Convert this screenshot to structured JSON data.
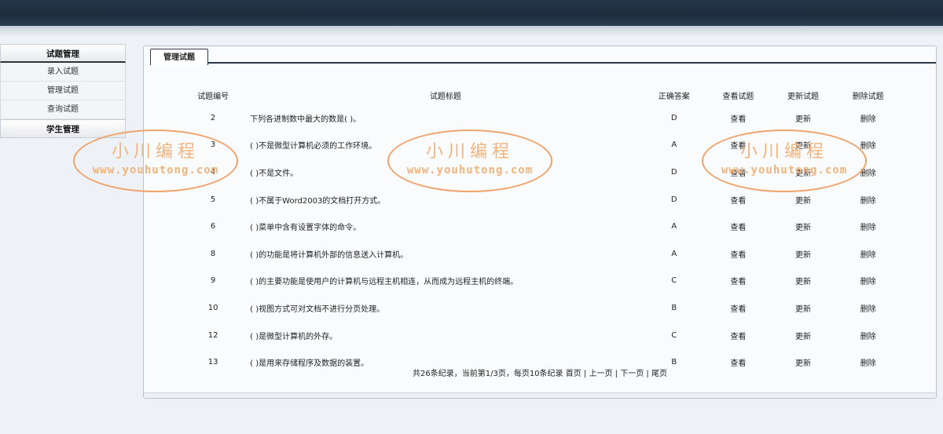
{
  "sidebar": {
    "sections": [
      {
        "label": "试题管理",
        "items": [
          "录入试题",
          "管理试题",
          "查询试题"
        ]
      },
      {
        "label": "学生管理",
        "items": []
      }
    ]
  },
  "main": {
    "tab_label": "管理试题",
    "columns": [
      "试题编号",
      "试题标题",
      "正确答案",
      "查看试题",
      "更新试题",
      "删除试题"
    ],
    "rows": [
      {
        "id": "2",
        "title": "下列各进制数中最大的数是( )。",
        "answer": "D",
        "view": "查看",
        "update": "更新",
        "delete": "删除"
      },
      {
        "id": "3",
        "title": "( )不是微型计算机必须的工作环境。",
        "answer": "A",
        "view": "查看",
        "update": "更新",
        "delete": "删除"
      },
      {
        "id": "4",
        "title": "( )不是文件。",
        "answer": "D",
        "view": "查看",
        "update": "更新",
        "delete": "删除"
      },
      {
        "id": "5",
        "title": "( )不属于Word2003的文档打开方式。",
        "answer": "D",
        "view": "查看",
        "update": "更新",
        "delete": "删除"
      },
      {
        "id": "6",
        "title": "( )菜单中含有设置字体的命令。",
        "answer": "A",
        "view": "查看",
        "update": "更新",
        "delete": "删除"
      },
      {
        "id": "8",
        "title": "( )的功能是将计算机外部的信息送入计算机。",
        "answer": "A",
        "view": "查看",
        "update": "更新",
        "delete": "删除"
      },
      {
        "id": "9",
        "title": "( )的主要功能是使用户的计算机与远程主机相连，从而成为远程主机的终端。",
        "answer": "C",
        "view": "查看",
        "update": "更新",
        "delete": "删除"
      },
      {
        "id": "10",
        "title": "( )视图方式可对文档不进行分页处理。",
        "answer": "B",
        "view": "查看",
        "update": "更新",
        "delete": "删除"
      },
      {
        "id": "12",
        "title": "( )是微型计算机的外存。",
        "answer": "C",
        "view": "查看",
        "update": "更新",
        "delete": "删除"
      },
      {
        "id": "13",
        "title": "( )是用来存储程序及数据的装置。",
        "answer": "B",
        "view": "查看",
        "update": "更新",
        "delete": "删除"
      }
    ],
    "pager": {
      "summary": "共26条纪录，当前第1/3页，每页10条纪录",
      "first": "首页",
      "prev": "上一页",
      "next": "下一页",
      "last": "尾页",
      "separator": "|"
    }
  },
  "watermark": {
    "line1": "小川编程",
    "line2": "www.youhutong.com"
  }
}
